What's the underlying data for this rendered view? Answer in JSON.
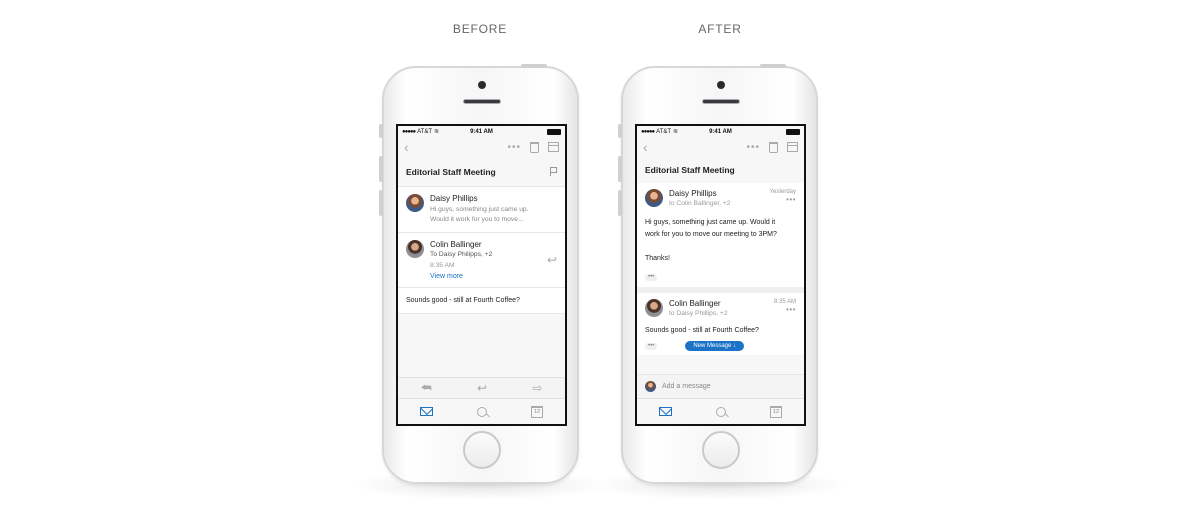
{
  "labels": {
    "before": "BEFORE",
    "after": "AFTER"
  },
  "status": {
    "carrier": "AT&T",
    "time": "9:41 AM"
  },
  "icons": [
    "back-icon",
    "more-icon",
    "trash-icon",
    "archive-icon",
    "flag-icon",
    "reply-icon",
    "reply-all-icon",
    "forward-icon",
    "mail-icon",
    "search-icon",
    "calendar-icon",
    "wifi-icon",
    "battery-icon"
  ],
  "colors": {
    "accent": "#1a73c7"
  },
  "before": {
    "subject": "Editorial Staff Meeting",
    "messages": [
      {
        "sender": "Daisy Phillips",
        "preview_line1": "Hi guys, something just came up.",
        "preview_line2": "Would it work for you to move..."
      },
      {
        "sender": "Colin Ballinger",
        "to": "To Daisy Philipps, +2",
        "time": "8:35 AM",
        "link": "View more"
      }
    ],
    "standalone": "Sounds good - still at Fourth Coffee?",
    "calendar_day": "12"
  },
  "after": {
    "subject": "Editorial Staff Meeting",
    "messages": [
      {
        "sender": "Daisy Phillips",
        "to": "to Colin Ballinger, +2",
        "time": "Yesterday",
        "body_line1": "Hi guys, something just came up. Would it",
        "body_line2": "work for you to move our meeting to 3PM?",
        "body_line3": "Thanks!"
      },
      {
        "sender": "Colin Ballinger",
        "to": "to Daisy Phillips, +2",
        "time": "8:35 AM",
        "body": "Sounds good - still at Fourth Coffee?",
        "new_message": "New Message ↓"
      }
    ],
    "compose_placeholder": "Add a message",
    "calendar_day": "12"
  }
}
